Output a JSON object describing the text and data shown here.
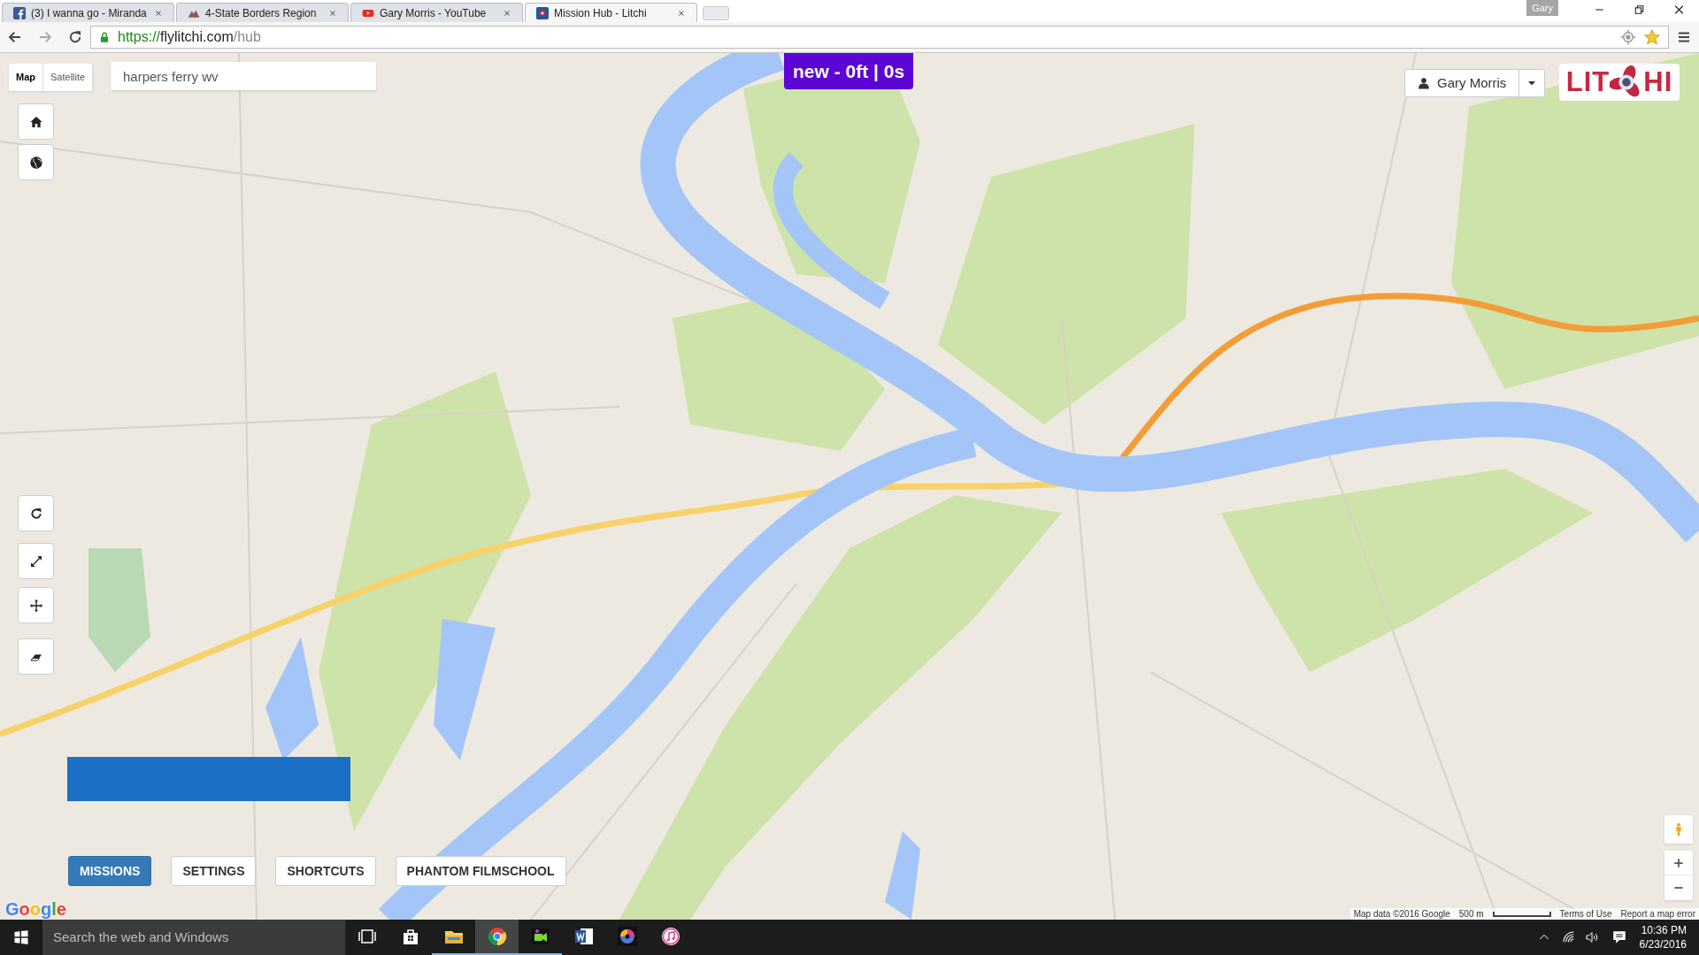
{
  "browser": {
    "profile": "Gary",
    "tabs": [
      {
        "kind": "facebook",
        "title": "(3) I wanna go - Miranda",
        "selected": false
      },
      {
        "kind": "mountain",
        "title": "4-State Borders Region",
        "selected": false
      },
      {
        "kind": "youtube",
        "title": "Gary Morris - YouTube",
        "selected": false
      },
      {
        "kind": "litchi",
        "title": "Mission Hub - Litchi",
        "selected": true
      }
    ],
    "url": {
      "scheme": "https://",
      "host": "flylitchi.com",
      "path": "/hub"
    }
  },
  "map": {
    "map_types": [
      {
        "label": "Map",
        "selected": true
      },
      {
        "label": "Satellite",
        "selected": false
      }
    ],
    "search": {
      "value": "harpers ferry wv"
    },
    "mission_badge": "new - 0ft | 0s",
    "user": "Gary Morris",
    "logo": {
      "left": "LIT",
      "right": "HI"
    },
    "bottom_tabs": [
      {
        "label": "MISSIONS",
        "selected": true
      },
      {
        "label": "SETTINGS",
        "selected": false
      },
      {
        "label": "SHORTCUTS",
        "selected": false
      },
      {
        "label": "PHANTOM FILMSCHOOL",
        "selected": false
      }
    ],
    "google": [
      "G",
      "o",
      "o",
      "g",
      "l",
      "e"
    ],
    "attribution": {
      "data": "Map data ©2016 Google",
      "scale": "500 m",
      "terms": "Terms of Use",
      "report": "Report a map error"
    }
  },
  "taskbar": {
    "search_placeholder": "Search the web and Windows",
    "apps": [
      {
        "kind": "taskview",
        "open": false,
        "active": false
      },
      {
        "kind": "store",
        "open": false,
        "active": false
      },
      {
        "kind": "explorer",
        "open": true,
        "active": false
      },
      {
        "kind": "chrome",
        "open": true,
        "active": true
      },
      {
        "kind": "video",
        "open": true,
        "active": false
      },
      {
        "kind": "word",
        "open": false,
        "active": false
      },
      {
        "kind": "disc",
        "open": false,
        "active": false
      },
      {
        "kind": "music",
        "open": false,
        "active": false
      }
    ],
    "time": "10:36 PM",
    "date": "6/23/2016"
  }
}
